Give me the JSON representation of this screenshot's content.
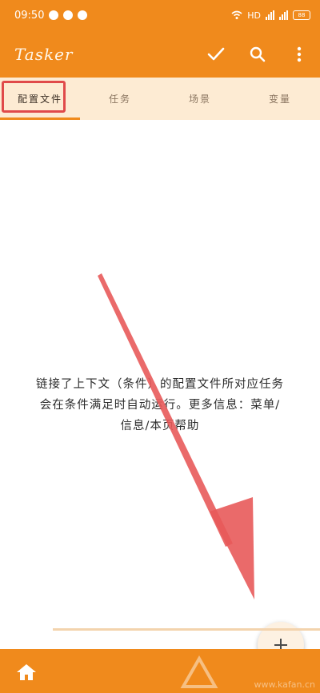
{
  "status_bar": {
    "time": "09:50",
    "network": "HD",
    "battery": "88"
  },
  "app_bar": {
    "title": "Tasker"
  },
  "tabs": [
    {
      "label": "配置文件",
      "active": true
    },
    {
      "label": "任务",
      "active": false
    },
    {
      "label": "场景",
      "active": false
    },
    {
      "label": "变量",
      "active": false
    }
  ],
  "content": {
    "empty_message_line1": "链接了上下文（条件）的配置文件所对应任务",
    "empty_message_line2": "会在条件满足时自动运行。更多信息：菜单/",
    "empty_message_line3": "信息/本页帮助"
  },
  "watermark": {
    "text": "www.kafan.cn"
  },
  "colors": {
    "primary": "#f08a1c",
    "tab_bg": "#fdebd3",
    "highlight": "#e04a4a"
  }
}
